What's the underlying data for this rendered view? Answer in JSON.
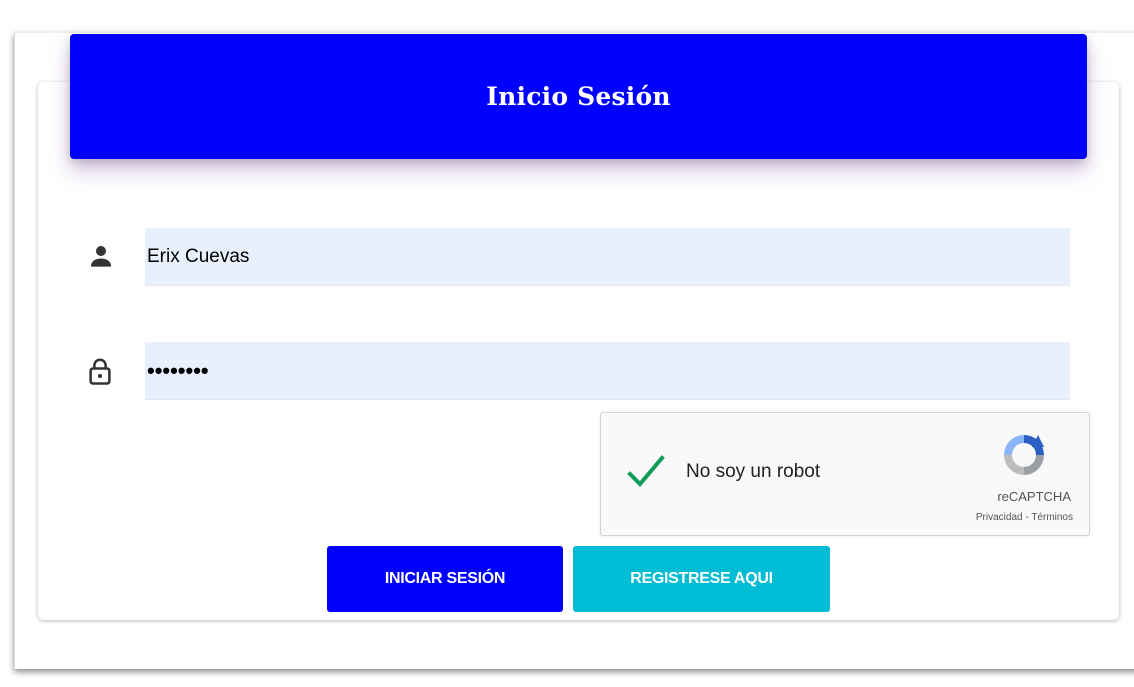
{
  "header": {
    "title": "Inicio Sesión"
  },
  "form": {
    "username": {
      "value": "Erix Cuevas",
      "icon": "person-icon"
    },
    "password": {
      "value": "Erix1234",
      "icon": "lock-icon"
    }
  },
  "recaptcha": {
    "checked": true,
    "label": "No soy un robot",
    "brand": "reCAPTCHA",
    "privacy_label": "Privacidad",
    "separator": " - ",
    "terms_label": "Términos"
  },
  "buttons": {
    "login_label": "INICIAR SESIÓN",
    "register_label": "REGISTRESE AQUI"
  },
  "colors": {
    "primary": "#0000fe",
    "secondary": "#00bcd4",
    "input_bg": "#e8f0fe",
    "check_green": "#0f9d58"
  }
}
